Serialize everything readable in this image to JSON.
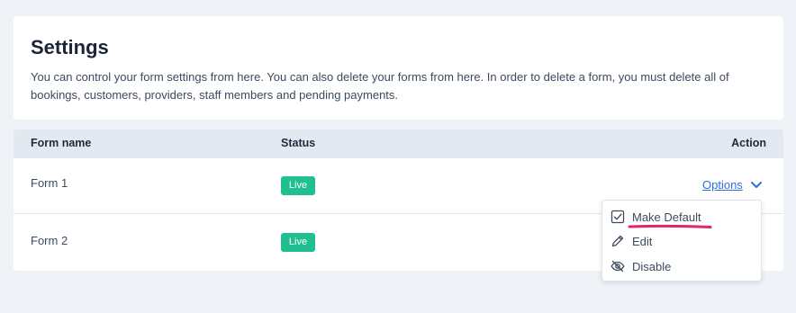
{
  "settings": {
    "title": "Settings",
    "description": "You can control your form settings from here. You can also delete your forms from here. In order to delete a form, you must delete all of bookings, customers, providers, staff members and pending payments."
  },
  "table": {
    "headers": {
      "name": "Form name",
      "status": "Status",
      "action": "Action"
    },
    "rows": [
      {
        "name": "Form 1",
        "status": "Live",
        "action": "Options"
      },
      {
        "name": "Form 2",
        "status": "Live"
      }
    ]
  },
  "menu": {
    "items": [
      {
        "label": "Make Default",
        "icon": "checkbox-checked-icon"
      },
      {
        "label": "Edit",
        "icon": "pencil-icon"
      },
      {
        "label": "Disable",
        "icon": "eye-off-icon"
      }
    ]
  },
  "colors": {
    "background": "#eff3f8",
    "header_bg": "#e3e9f1",
    "badge": "#1fbf8f",
    "link": "#2f6fe0",
    "highlight": "#e0256a"
  }
}
